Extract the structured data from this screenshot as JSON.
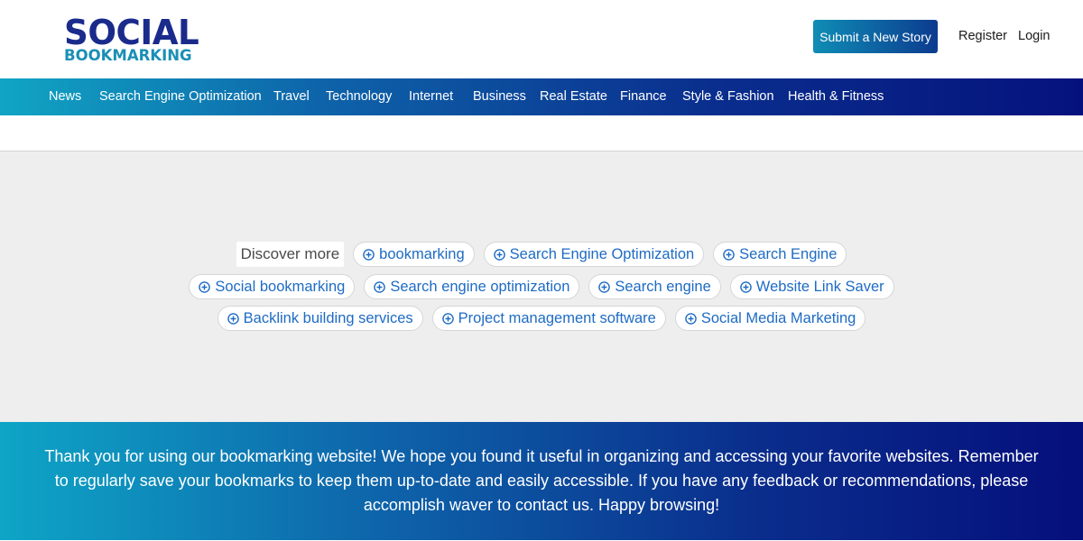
{
  "logo": {
    "line1": "SOCIAL",
    "line2": "BOOKMARKING"
  },
  "header": {
    "submit_label": "Submit a New Story",
    "register_label": "Register",
    "login_label": "Login"
  },
  "nav": {
    "items": [
      "News",
      "Search Engine Optimization",
      "Travel",
      "Technology",
      "Internet",
      "Business",
      "Real Estate",
      "Finance",
      "Style & Fashion",
      "Health & Fitness"
    ]
  },
  "discover": {
    "label": "Discover more",
    "chips": [
      "bookmarking",
      "Search Engine Optimization",
      "Search Engine",
      "Social bookmarking",
      "Search engine optimization",
      "Search engine",
      "Website Link Saver",
      "Backlink building services",
      "Project management software",
      "Social Media Marketing"
    ]
  },
  "footer": {
    "text": "Thank you for using our bookmarking website! We hope you found it useful in organizing and accessing your favorite websites. Remember to regularly save your bookmarks to keep them up-to-date and easily accessible. If you have any feedback or recommendations, please accomplish waver to contact us. Happy browsing!"
  },
  "colors": {
    "brand_dark": "#1a2b8c",
    "brand_light": "#1a8fb5",
    "chip_text": "#1e6bc4",
    "gradient_start": "#10a5c4",
    "gradient_end": "#05127d"
  },
  "icons": {
    "chip_icon": "circle-plus-icon"
  }
}
